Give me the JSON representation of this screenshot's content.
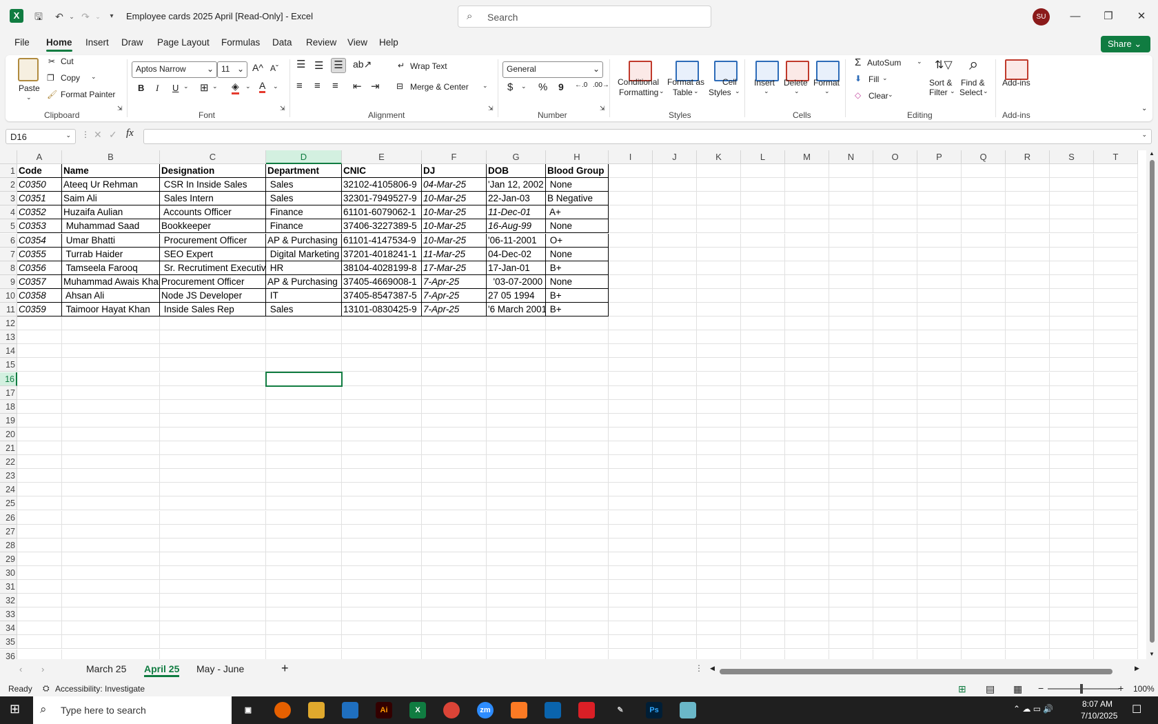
{
  "window": {
    "title": "Employee cards 2025 April  [Read-Only]  -  Excel",
    "search_placeholder": "Search",
    "avatar": "SU"
  },
  "menu": [
    "File",
    "Home",
    "Insert",
    "Draw",
    "Page Layout",
    "Formulas",
    "Data",
    "Review",
    "View",
    "Help"
  ],
  "share": "Share",
  "ribbon": {
    "clipboard": {
      "paste": "Paste",
      "cut": "Cut",
      "copy": "Copy",
      "format_painter": "Format Painter",
      "label": "Clipboard"
    },
    "font": {
      "name": "Aptos Narrow",
      "size": "11",
      "bold": "B",
      "italic": "I",
      "underline": "U",
      "label": "Font"
    },
    "alignment": {
      "wrap": "Wrap Text",
      "merge": "Merge & Center",
      "label": "Alignment"
    },
    "number": {
      "format": "General",
      "currency": "$",
      "percent": "%",
      "comma": "9",
      "label": "Number"
    },
    "styles": {
      "conditional": "Conditional",
      "conditional2": "Formatting",
      "format_table": "Format as",
      "format_table2": "Table",
      "cell_styles": "Cell",
      "cell_styles2": "Styles",
      "label": "Styles"
    },
    "cells": {
      "insert": "Insert",
      "delete": "Delete",
      "format": "Format",
      "label": "Cells"
    },
    "editing": {
      "autosum": "AutoSum",
      "fill": "Fill",
      "clear": "Clear",
      "sort": "Sort &",
      "sort2": "Filter",
      "find": "Find &",
      "find2": "Select",
      "label": "Editing"
    },
    "addins": {
      "addins": "Add-ins",
      "label": "Add-ins"
    }
  },
  "namebox": "D16",
  "columns": [
    "A",
    "B",
    "C",
    "D",
    "E",
    "F",
    "G",
    "H",
    "I",
    "J",
    "K",
    "L",
    "M",
    "N",
    "O",
    "P",
    "Q",
    "R",
    "S",
    "T"
  ],
  "table": {
    "headers": [
      "Code",
      "Name",
      "Designation",
      "Department",
      "CNIC",
      "DJ",
      "DOB",
      "Blood Group"
    ],
    "rows": [
      [
        "C0350",
        "Ateeq Ur Rehman",
        " CSR In Inside Sales",
        " Sales",
        "32102-4105806-9",
        "04-Mar-25",
        "'Jan 12, 2002",
        " None"
      ],
      [
        "C0351",
        "Saim Ali",
        " Sales Intern",
        " Sales",
        "32301-7949527-9",
        "10-Mar-25",
        "22-Jan-03",
        "B Negative"
      ],
      [
        "C0352",
        "Huzaifa Aulian",
        " Accounts Officer",
        " Finance",
        "61101-6079062-1",
        "10-Mar-25",
        "11-Dec-01",
        " A+"
      ],
      [
        "C0353",
        " Muhammad Saad",
        "Bookkeeper",
        " Finance",
        "37406-3227389-5",
        "10-Mar-25",
        "16-Aug-99",
        " None"
      ],
      [
        "C0354",
        " Umar Bhatti",
        " Procurement Officer",
        "AP & Purchasing",
        "61101-4147534-9",
        "10-Mar-25",
        "'06-11-2001",
        " O+"
      ],
      [
        "C0355",
        " Turrab Haider",
        " SEO Expert",
        " Digital Marketing",
        "37201-4018241-1",
        "11-Mar-25",
        "04-Dec-02",
        " None"
      ],
      [
        "C0356",
        " Tamseela Farooq",
        " Sr. Recrutiment Executive",
        " HR",
        "38104-4028199-8",
        "17-Mar-25",
        "17-Jan-01",
        " B+"
      ],
      [
        "C0357",
        "Muhammad Awais Khan",
        "Procurement Officer",
        "AP & Purchasing",
        "37405-4669008-1",
        "7-Apr-25",
        "  '03-07-2000",
        " None"
      ],
      [
        "C0358",
        " Ahsan Ali",
        "Node JS Developer",
        " IT",
        "37405-8547387-5",
        "7-Apr-25",
        "27 05 1994",
        " B+"
      ],
      [
        "C0359",
        " Taimoor Hayat Khan",
        " Inside Sales Rep",
        " Sales",
        "13101-0830425-9",
        "7-Apr-25",
        "'6 March 2001",
        " B+"
      ]
    ]
  },
  "row_numbers": [
    "1",
    "2",
    "3",
    "4",
    "5",
    "6",
    "7",
    "8",
    "9",
    "10",
    "11",
    "12",
    "13",
    "14",
    "15",
    "16",
    "17",
    "18",
    "19",
    "20",
    "21",
    "22",
    "23",
    "24",
    "25",
    "26",
    "27",
    "28",
    "29",
    "30",
    "31",
    "32",
    "33",
    "34",
    "35",
    "36"
  ],
  "sheets": [
    "March 25",
    "April 25",
    "May - June"
  ],
  "status": {
    "ready": "Ready",
    "accessibility": "Accessibility: Investigate",
    "zoom": "100%"
  },
  "taskbar": {
    "search_placeholder": "Type here to search",
    "time": "8:07 AM",
    "date": "7/10/2025"
  }
}
